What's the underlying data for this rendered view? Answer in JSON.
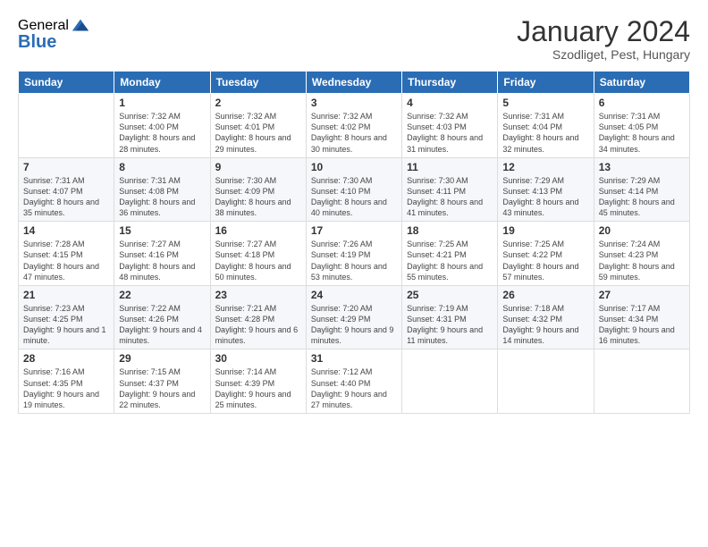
{
  "logo": {
    "general": "General",
    "blue": "Blue"
  },
  "title": "January 2024",
  "subtitle": "Szodliget, Pest, Hungary",
  "days_of_week": [
    "Sunday",
    "Monday",
    "Tuesday",
    "Wednesday",
    "Thursday",
    "Friday",
    "Saturday"
  ],
  "weeks": [
    [
      {
        "day": "",
        "sunrise": "",
        "sunset": "",
        "daylight": ""
      },
      {
        "day": "1",
        "sunrise": "Sunrise: 7:32 AM",
        "sunset": "Sunset: 4:00 PM",
        "daylight": "Daylight: 8 hours and 28 minutes."
      },
      {
        "day": "2",
        "sunrise": "Sunrise: 7:32 AM",
        "sunset": "Sunset: 4:01 PM",
        "daylight": "Daylight: 8 hours and 29 minutes."
      },
      {
        "day": "3",
        "sunrise": "Sunrise: 7:32 AM",
        "sunset": "Sunset: 4:02 PM",
        "daylight": "Daylight: 8 hours and 30 minutes."
      },
      {
        "day": "4",
        "sunrise": "Sunrise: 7:32 AM",
        "sunset": "Sunset: 4:03 PM",
        "daylight": "Daylight: 8 hours and 31 minutes."
      },
      {
        "day": "5",
        "sunrise": "Sunrise: 7:31 AM",
        "sunset": "Sunset: 4:04 PM",
        "daylight": "Daylight: 8 hours and 32 minutes."
      },
      {
        "day": "6",
        "sunrise": "Sunrise: 7:31 AM",
        "sunset": "Sunset: 4:05 PM",
        "daylight": "Daylight: 8 hours and 34 minutes."
      }
    ],
    [
      {
        "day": "7",
        "sunrise": "Sunrise: 7:31 AM",
        "sunset": "Sunset: 4:07 PM",
        "daylight": "Daylight: 8 hours and 35 minutes."
      },
      {
        "day": "8",
        "sunrise": "Sunrise: 7:31 AM",
        "sunset": "Sunset: 4:08 PM",
        "daylight": "Daylight: 8 hours and 36 minutes."
      },
      {
        "day": "9",
        "sunrise": "Sunrise: 7:30 AM",
        "sunset": "Sunset: 4:09 PM",
        "daylight": "Daylight: 8 hours and 38 minutes."
      },
      {
        "day": "10",
        "sunrise": "Sunrise: 7:30 AM",
        "sunset": "Sunset: 4:10 PM",
        "daylight": "Daylight: 8 hours and 40 minutes."
      },
      {
        "day": "11",
        "sunrise": "Sunrise: 7:30 AM",
        "sunset": "Sunset: 4:11 PM",
        "daylight": "Daylight: 8 hours and 41 minutes."
      },
      {
        "day": "12",
        "sunrise": "Sunrise: 7:29 AM",
        "sunset": "Sunset: 4:13 PM",
        "daylight": "Daylight: 8 hours and 43 minutes."
      },
      {
        "day": "13",
        "sunrise": "Sunrise: 7:29 AM",
        "sunset": "Sunset: 4:14 PM",
        "daylight": "Daylight: 8 hours and 45 minutes."
      }
    ],
    [
      {
        "day": "14",
        "sunrise": "Sunrise: 7:28 AM",
        "sunset": "Sunset: 4:15 PM",
        "daylight": "Daylight: 8 hours and 47 minutes."
      },
      {
        "day": "15",
        "sunrise": "Sunrise: 7:27 AM",
        "sunset": "Sunset: 4:16 PM",
        "daylight": "Daylight: 8 hours and 48 minutes."
      },
      {
        "day": "16",
        "sunrise": "Sunrise: 7:27 AM",
        "sunset": "Sunset: 4:18 PM",
        "daylight": "Daylight: 8 hours and 50 minutes."
      },
      {
        "day": "17",
        "sunrise": "Sunrise: 7:26 AM",
        "sunset": "Sunset: 4:19 PM",
        "daylight": "Daylight: 8 hours and 53 minutes."
      },
      {
        "day": "18",
        "sunrise": "Sunrise: 7:25 AM",
        "sunset": "Sunset: 4:21 PM",
        "daylight": "Daylight: 8 hours and 55 minutes."
      },
      {
        "day": "19",
        "sunrise": "Sunrise: 7:25 AM",
        "sunset": "Sunset: 4:22 PM",
        "daylight": "Daylight: 8 hours and 57 minutes."
      },
      {
        "day": "20",
        "sunrise": "Sunrise: 7:24 AM",
        "sunset": "Sunset: 4:23 PM",
        "daylight": "Daylight: 8 hours and 59 minutes."
      }
    ],
    [
      {
        "day": "21",
        "sunrise": "Sunrise: 7:23 AM",
        "sunset": "Sunset: 4:25 PM",
        "daylight": "Daylight: 9 hours and 1 minute."
      },
      {
        "day": "22",
        "sunrise": "Sunrise: 7:22 AM",
        "sunset": "Sunset: 4:26 PM",
        "daylight": "Daylight: 9 hours and 4 minutes."
      },
      {
        "day": "23",
        "sunrise": "Sunrise: 7:21 AM",
        "sunset": "Sunset: 4:28 PM",
        "daylight": "Daylight: 9 hours and 6 minutes."
      },
      {
        "day": "24",
        "sunrise": "Sunrise: 7:20 AM",
        "sunset": "Sunset: 4:29 PM",
        "daylight": "Daylight: 9 hours and 9 minutes."
      },
      {
        "day": "25",
        "sunrise": "Sunrise: 7:19 AM",
        "sunset": "Sunset: 4:31 PM",
        "daylight": "Daylight: 9 hours and 11 minutes."
      },
      {
        "day": "26",
        "sunrise": "Sunrise: 7:18 AM",
        "sunset": "Sunset: 4:32 PM",
        "daylight": "Daylight: 9 hours and 14 minutes."
      },
      {
        "day": "27",
        "sunrise": "Sunrise: 7:17 AM",
        "sunset": "Sunset: 4:34 PM",
        "daylight": "Daylight: 9 hours and 16 minutes."
      }
    ],
    [
      {
        "day": "28",
        "sunrise": "Sunrise: 7:16 AM",
        "sunset": "Sunset: 4:35 PM",
        "daylight": "Daylight: 9 hours and 19 minutes."
      },
      {
        "day": "29",
        "sunrise": "Sunrise: 7:15 AM",
        "sunset": "Sunset: 4:37 PM",
        "daylight": "Daylight: 9 hours and 22 minutes."
      },
      {
        "day": "30",
        "sunrise": "Sunrise: 7:14 AM",
        "sunset": "Sunset: 4:39 PM",
        "daylight": "Daylight: 9 hours and 25 minutes."
      },
      {
        "day": "31",
        "sunrise": "Sunrise: 7:12 AM",
        "sunset": "Sunset: 4:40 PM",
        "daylight": "Daylight: 9 hours and 27 minutes."
      },
      {
        "day": "",
        "sunrise": "",
        "sunset": "",
        "daylight": ""
      },
      {
        "day": "",
        "sunrise": "",
        "sunset": "",
        "daylight": ""
      },
      {
        "day": "",
        "sunrise": "",
        "sunset": "",
        "daylight": ""
      }
    ]
  ]
}
